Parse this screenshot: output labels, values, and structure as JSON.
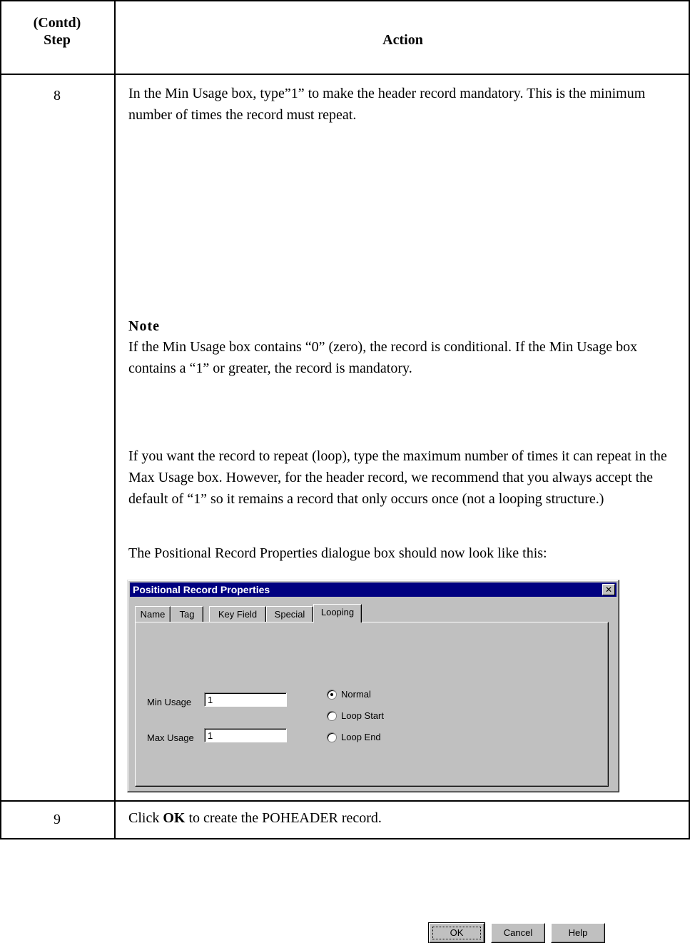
{
  "header": {
    "step_line1": "(Contd)",
    "step_line2": "Step",
    "action": "Action"
  },
  "rows": [
    {
      "step": "8",
      "intro": "In the Min Usage box, type”1” to make the header record mandatory. This is the minimum number of times the record must repeat.",
      "note_title": "Note",
      "note_body": "If the Min Usage box contains “0” (zero), the record is conditional. If the Min Usage box contains a “1” or greater, the record is mandatory.",
      "loop_text": "If you want the record to repeat (loop), type the maximum number of times it can repeat in the Max Usage box. However, for the header record, we recommend that you always accept the default of “1” so it remains a record that only occurs once (not a looping structure.)",
      "lead_in": "The Positional Record Properties dialogue box should now look like this:"
    },
    {
      "step": "9",
      "text_before": "Click ",
      "text_bold": "OK",
      "text_after": " to create the POHEADER record."
    }
  ],
  "dialog": {
    "title": "Positional Record Properties",
    "close_glyph": "✕",
    "tabs": [
      "Name",
      "Tag",
      "Key Field",
      "Special",
      "Looping"
    ],
    "active_tab": "Looping",
    "min_usage_label": "Min Usage",
    "min_usage_value": "1",
    "max_usage_label": "Max Usage",
    "max_usage_value": "1",
    "radio_options": [
      "Normal",
      "Loop Start",
      "Loop End"
    ],
    "radio_selected": "Normal",
    "buttons": {
      "ok": "OK",
      "cancel": "Cancel",
      "help": "Help"
    }
  }
}
